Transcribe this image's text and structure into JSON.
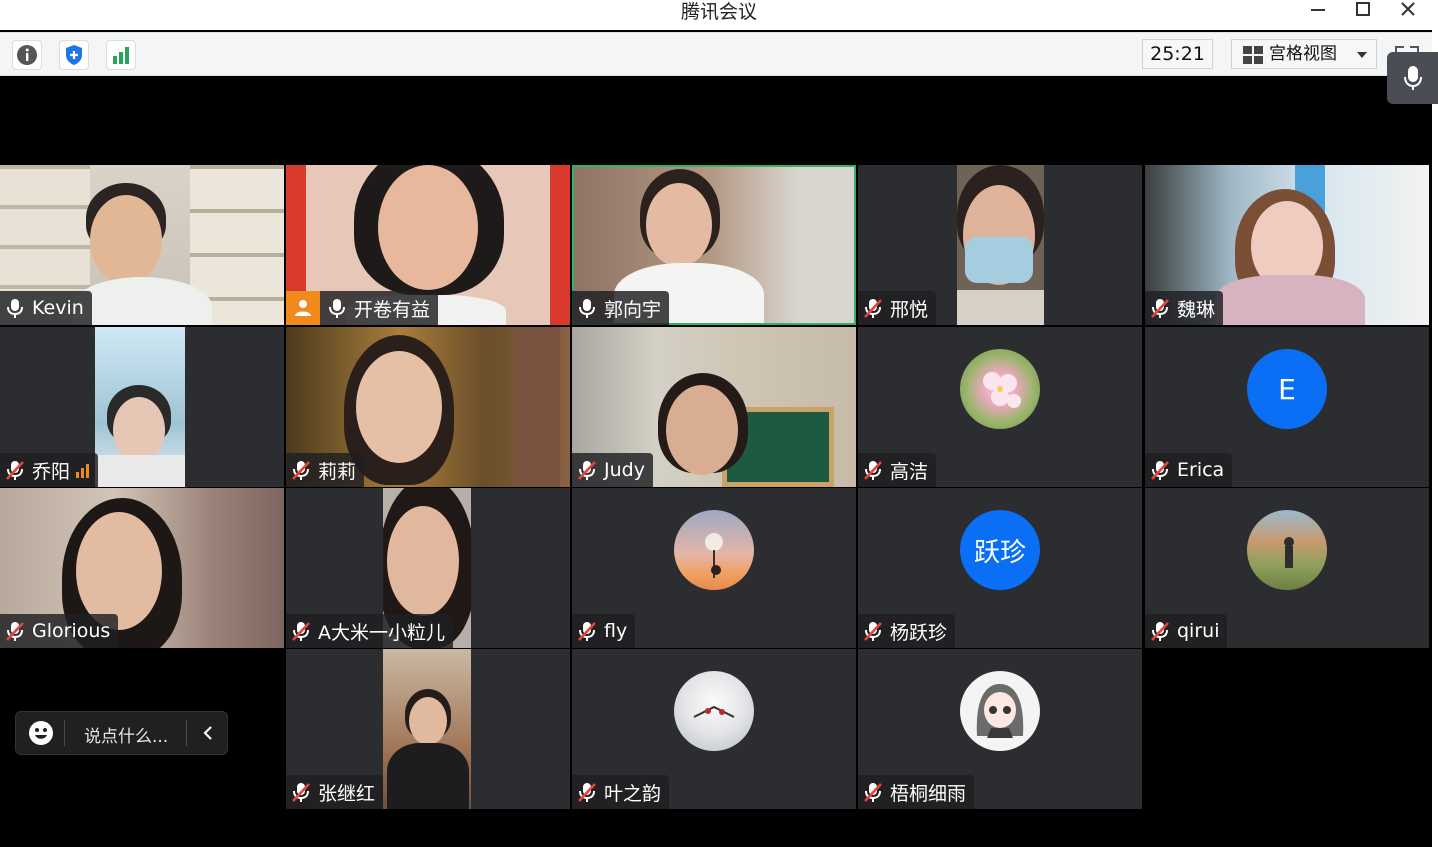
{
  "window": {
    "title": "腾讯会议"
  },
  "toolbar": {
    "timer": "25:21",
    "view_label": "宫格视图"
  },
  "participants": [
    {
      "name": "Kevin",
      "mic": "on",
      "video": true
    },
    {
      "name": "开卷有益",
      "mic": "on",
      "video": true
    },
    {
      "name": "郭向宇",
      "mic": "on",
      "video": true,
      "speaking": true
    },
    {
      "name": "邢悦",
      "mic": "muted",
      "video": true
    },
    {
      "name": "魏琳",
      "mic": "muted",
      "video": true
    },
    {
      "name": "乔阳",
      "mic": "muted",
      "video": true
    },
    {
      "name": "莉莉",
      "mic": "muted",
      "video": true
    },
    {
      "name": "Judy",
      "mic": "muted",
      "video": true
    },
    {
      "name": "高洁",
      "mic": "muted",
      "video": false,
      "avatar": "flower"
    },
    {
      "name": "Erica",
      "mic": "muted",
      "video": false,
      "avatar_text": "E"
    },
    {
      "name": "Glorious",
      "mic": "muted",
      "video": true
    },
    {
      "name": "A大米一小粒儿",
      "mic": "muted",
      "video": true
    },
    {
      "name": "fly",
      "mic": "muted",
      "video": false,
      "avatar": "dandelion"
    },
    {
      "name": "杨跃珍",
      "mic": "muted",
      "video": false,
      "avatar_text": "跃珍"
    },
    {
      "name": "qirui",
      "mic": "muted",
      "video": false,
      "avatar": "landscape"
    },
    {
      "name": "张继红",
      "mic": "muted",
      "video": true
    },
    {
      "name": "叶之韵",
      "mic": "muted",
      "video": false,
      "avatar": "snow-branch"
    },
    {
      "name": "梧桐细雨",
      "mic": "muted",
      "video": false,
      "avatar": "anime-girl"
    }
  ],
  "chat": {
    "placeholder": "说点什么..."
  },
  "colors": {
    "accent_blue": "#0b6ff5",
    "active_green": "#2fb36a",
    "muted_red": "#e2453c"
  }
}
